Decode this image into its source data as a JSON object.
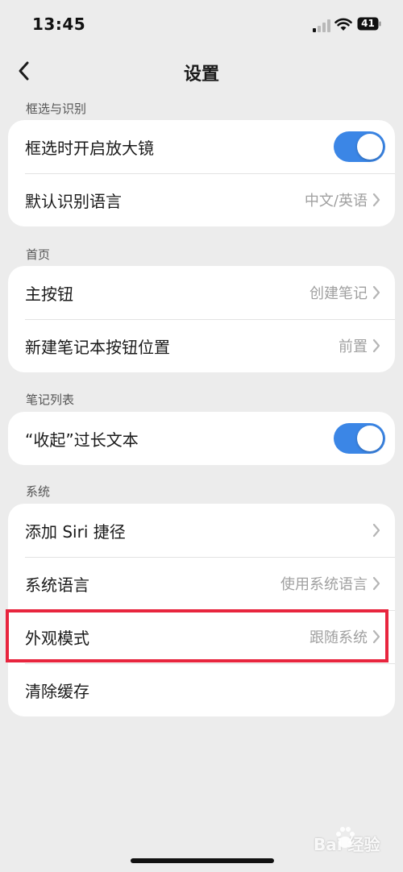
{
  "status_bar": {
    "time": "13:45",
    "battery": "41"
  },
  "nav": {
    "title": "设置"
  },
  "sections": [
    {
      "header": "框选与识别",
      "rows": [
        {
          "label": "框选时开启放大镜",
          "toggle": true
        },
        {
          "label": "默认识别语言",
          "value": "中文/英语"
        }
      ]
    },
    {
      "header": "首页",
      "rows": [
        {
          "label": "主按钮",
          "value": "创建笔记"
        },
        {
          "label": "新建笔记本按钮位置",
          "value": "前置"
        }
      ]
    },
    {
      "header": "笔记列表",
      "rows": [
        {
          "label": "“收起”过长文本",
          "toggle": true
        }
      ]
    },
    {
      "header": "系统",
      "rows": [
        {
          "label": "添加 Siri 捷径",
          "value": ""
        },
        {
          "label": "系统语言",
          "value": "使用系统语言"
        },
        {
          "label": "外观模式",
          "value": "跟随系统"
        },
        {
          "label": "清除缓存"
        }
      ]
    }
  ],
  "watermark": {
    "text": "Bai  经验"
  },
  "colors": {
    "accent": "#3b86e6",
    "highlight": "#e8253e",
    "background": "#ececec"
  }
}
